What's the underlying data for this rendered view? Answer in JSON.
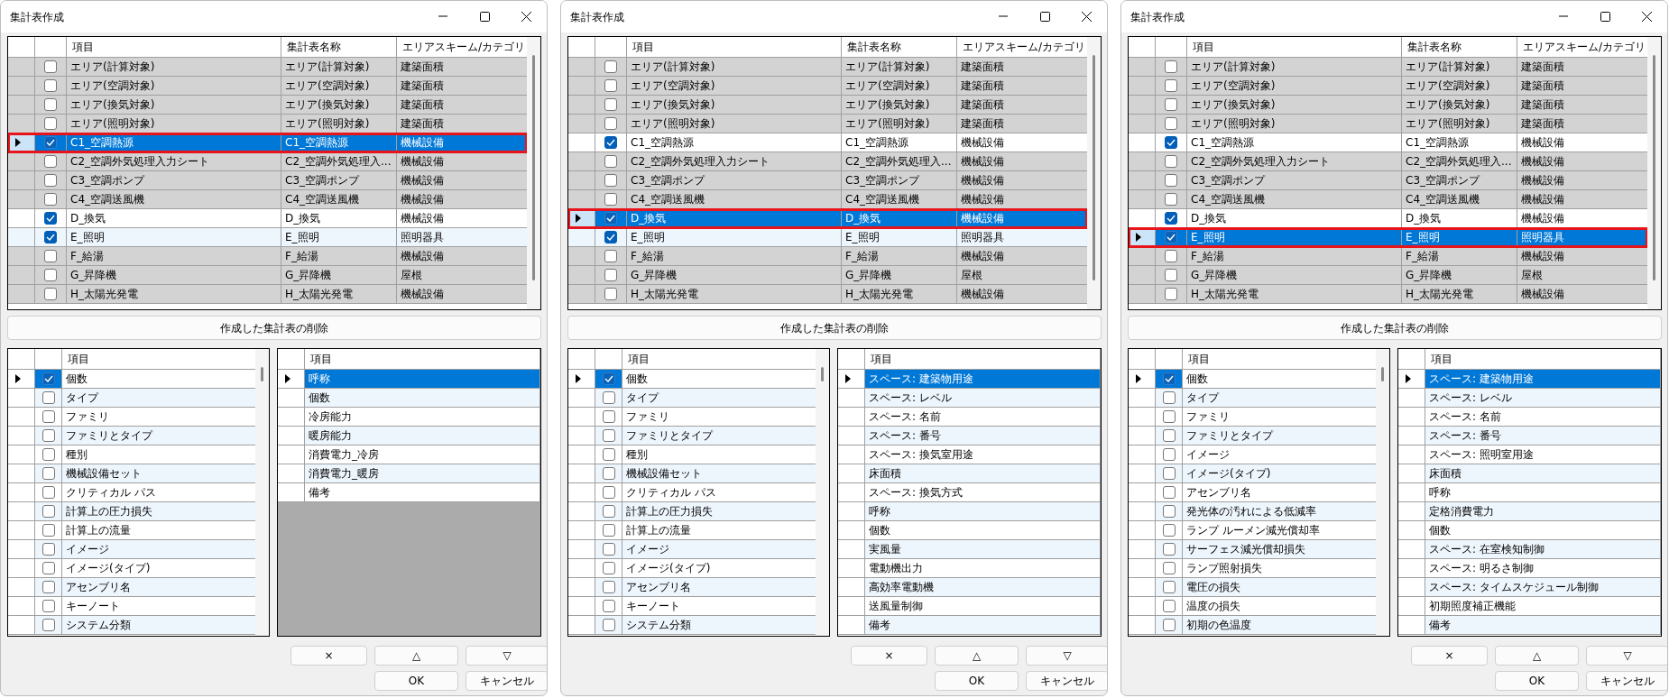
{
  "dialogs": [
    {
      "title": "集計表作成",
      "schedule_table": {
        "columns": [
          "項目",
          "集計表名称",
          "エリアスキーム/カテゴリ"
        ],
        "rows": [
          {
            "checked": false,
            "selected": false,
            "item": "エリア(計算対象)",
            "schedule_name": "エリア(計算対象)",
            "category": "建築面積"
          },
          {
            "checked": false,
            "selected": false,
            "item": "エリア(空調対象)",
            "schedule_name": "エリア(空調対象)",
            "category": "建築面積"
          },
          {
            "checked": false,
            "selected": false,
            "item": "エリア(換気対象)",
            "schedule_name": "エリア(換気対象)",
            "category": "建築面積"
          },
          {
            "checked": false,
            "selected": false,
            "item": "エリア(照明対象)",
            "schedule_name": "エリア(照明対象)",
            "category": "建築面積"
          },
          {
            "checked": true,
            "selected": true,
            "item": "C1_空調熱源",
            "schedule_name": "C1_空調熱源",
            "category": "機械設備"
          },
          {
            "checked": false,
            "selected": false,
            "item": "C2_空調外気処理入力シート",
            "schedule_name": "C2_空調外気処理入...",
            "category": "機械設備"
          },
          {
            "checked": false,
            "selected": false,
            "item": "C3_空調ポンプ",
            "schedule_name": "C3_空調ポンプ",
            "category": "機械設備"
          },
          {
            "checked": false,
            "selected": false,
            "item": "C4_空調送風機",
            "schedule_name": "C4_空調送風機",
            "category": "機械設備"
          },
          {
            "checked": true,
            "selected": false,
            "item": "D_換気",
            "schedule_name": "D_換気",
            "category": "機械設備"
          },
          {
            "checked": true,
            "selected": false,
            "item": "E_照明",
            "schedule_name": "E_照明",
            "category": "照明器具"
          },
          {
            "checked": false,
            "selected": false,
            "item": "F_給湯",
            "schedule_name": "F_給湯",
            "category": "機械設備"
          },
          {
            "checked": false,
            "selected": false,
            "item": "G_昇降機",
            "schedule_name": "G_昇降機",
            "category": "屋根"
          },
          {
            "checked": false,
            "selected": false,
            "item": "H_太陽光発電",
            "schedule_name": "H_太陽光発電",
            "category": "機械設備"
          }
        ]
      },
      "delete_button": "作成した集計表の削除",
      "field_list": {
        "column": "項目",
        "rows": [
          {
            "label": "個数",
            "checked": true,
            "selected": true
          },
          {
            "label": "タイプ",
            "checked": false,
            "selected": false
          },
          {
            "label": "ファミリ",
            "checked": false,
            "selected": false
          },
          {
            "label": "ファミリとタイプ",
            "checked": false,
            "selected": false
          },
          {
            "label": "種別",
            "checked": false,
            "selected": false
          },
          {
            "label": "機械設備セット",
            "checked": false,
            "selected": false
          },
          {
            "label": "クリティカル パス",
            "checked": false,
            "selected": false
          },
          {
            "label": "計算上の圧力損失",
            "checked": false,
            "selected": false
          },
          {
            "label": "計算上の流量",
            "checked": false,
            "selected": false
          },
          {
            "label": "イメージ",
            "checked": false,
            "selected": false
          },
          {
            "label": "イメージ(タイプ)",
            "checked": false,
            "selected": false
          },
          {
            "label": "アセンブリ名",
            "checked": false,
            "selected": false
          },
          {
            "label": "キーノート",
            "checked": false,
            "selected": false
          },
          {
            "label": "システム分類",
            "checked": false,
            "selected": false
          }
        ]
      },
      "selected_fields": {
        "column": "項目",
        "rows": [
          {
            "label": "呼称",
            "selected": true
          },
          {
            "label": "個数",
            "selected": false
          },
          {
            "label": "冷房能力",
            "selected": false
          },
          {
            "label": "暖房能力",
            "selected": false
          },
          {
            "label": "消費電力_冷房",
            "selected": false
          },
          {
            "label": "消費電力_暖房",
            "selected": false
          },
          {
            "label": "備考",
            "selected": false
          }
        ]
      },
      "buttons": [
        "×",
        "△",
        "▽",
        "OK",
        "キャンセル"
      ]
    },
    {
      "title": "集計表作成",
      "schedule_table": {
        "columns": [
          "項目",
          "集計表名称",
          "エリアスキーム/カテゴリ"
        ],
        "rows": [
          {
            "checked": false,
            "selected": false,
            "item": "エリア(計算対象)",
            "schedule_name": "エリア(計算対象)",
            "category": "建築面積"
          },
          {
            "checked": false,
            "selected": false,
            "item": "エリア(空調対象)",
            "schedule_name": "エリア(空調対象)",
            "category": "建築面積"
          },
          {
            "checked": false,
            "selected": false,
            "item": "エリア(換気対象)",
            "schedule_name": "エリア(換気対象)",
            "category": "建築面積"
          },
          {
            "checked": false,
            "selected": false,
            "item": "エリア(照明対象)",
            "schedule_name": "エリア(照明対象)",
            "category": "建築面積"
          },
          {
            "checked": true,
            "selected": false,
            "item": "C1_空調熱源",
            "schedule_name": "C1_空調熱源",
            "category": "機械設備"
          },
          {
            "checked": false,
            "selected": false,
            "item": "C2_空調外気処理入力シート",
            "schedule_name": "C2_空調外気処理入...",
            "category": "機械設備"
          },
          {
            "checked": false,
            "selected": false,
            "item": "C3_空調ポンプ",
            "schedule_name": "C3_空調ポンプ",
            "category": "機械設備"
          },
          {
            "checked": false,
            "selected": false,
            "item": "C4_空調送風機",
            "schedule_name": "C4_空調送風機",
            "category": "機械設備"
          },
          {
            "checked": true,
            "selected": true,
            "item": "D_換気",
            "schedule_name": "D_換気",
            "category": "機械設備"
          },
          {
            "checked": true,
            "selected": false,
            "item": "E_照明",
            "schedule_name": "E_照明",
            "category": "照明器具"
          },
          {
            "checked": false,
            "selected": false,
            "item": "F_給湯",
            "schedule_name": "F_給湯",
            "category": "機械設備"
          },
          {
            "checked": false,
            "selected": false,
            "item": "G_昇降機",
            "schedule_name": "G_昇降機",
            "category": "屋根"
          },
          {
            "checked": false,
            "selected": false,
            "item": "H_太陽光発電",
            "schedule_name": "H_太陽光発電",
            "category": "機械設備"
          }
        ]
      },
      "delete_button": "作成した集計表の削除",
      "field_list": {
        "column": "項目",
        "rows": [
          {
            "label": "個数",
            "checked": true,
            "selected": true
          },
          {
            "label": "タイプ",
            "checked": false,
            "selected": false
          },
          {
            "label": "ファミリ",
            "checked": false,
            "selected": false
          },
          {
            "label": "ファミリとタイプ",
            "checked": false,
            "selected": false
          },
          {
            "label": "種別",
            "checked": false,
            "selected": false
          },
          {
            "label": "機械設備セット",
            "checked": false,
            "selected": false
          },
          {
            "label": "クリティカル パス",
            "checked": false,
            "selected": false
          },
          {
            "label": "計算上の圧力損失",
            "checked": false,
            "selected": false
          },
          {
            "label": "計算上の流量",
            "checked": false,
            "selected": false
          },
          {
            "label": "イメージ",
            "checked": false,
            "selected": false
          },
          {
            "label": "イメージ(タイプ)",
            "checked": false,
            "selected": false
          },
          {
            "label": "アセンブリ名",
            "checked": false,
            "selected": false
          },
          {
            "label": "キーノート",
            "checked": false,
            "selected": false
          },
          {
            "label": "システム分類",
            "checked": false,
            "selected": false
          }
        ]
      },
      "selected_fields": {
        "column": "項目",
        "rows": [
          {
            "label": "スペース: 建築物用途",
            "selected": true
          },
          {
            "label": "スペース: レベル",
            "selected": false
          },
          {
            "label": "スペース: 名前",
            "selected": false
          },
          {
            "label": "スペース: 番号",
            "selected": false
          },
          {
            "label": "スペース: 換気室用途",
            "selected": false
          },
          {
            "label": "床面積",
            "selected": false
          },
          {
            "label": "スペース: 換気方式",
            "selected": false
          },
          {
            "label": "呼称",
            "selected": false
          },
          {
            "label": "個数",
            "selected": false
          },
          {
            "label": "実風量",
            "selected": false
          },
          {
            "label": "電動機出力",
            "selected": false
          },
          {
            "label": "高効率電動機",
            "selected": false
          },
          {
            "label": "送風量制御",
            "selected": false
          },
          {
            "label": "備考",
            "selected": false
          }
        ]
      },
      "buttons": [
        "×",
        "△",
        "▽",
        "OK",
        "キャンセル"
      ]
    },
    {
      "title": "集計表作成",
      "schedule_table": {
        "columns": [
          "項目",
          "集計表名称",
          "エリアスキーム/カテゴリ"
        ],
        "rows": [
          {
            "checked": false,
            "selected": false,
            "item": "エリア(計算対象)",
            "schedule_name": "エリア(計算対象)",
            "category": "建築面積"
          },
          {
            "checked": false,
            "selected": false,
            "item": "エリア(空調対象)",
            "schedule_name": "エリア(空調対象)",
            "category": "建築面積"
          },
          {
            "checked": false,
            "selected": false,
            "item": "エリア(換気対象)",
            "schedule_name": "エリア(換気対象)",
            "category": "建築面積"
          },
          {
            "checked": false,
            "selected": false,
            "item": "エリア(照明対象)",
            "schedule_name": "エリア(照明対象)",
            "category": "建築面積"
          },
          {
            "checked": true,
            "selected": false,
            "item": "C1_空調熱源",
            "schedule_name": "C1_空調熱源",
            "category": "機械設備"
          },
          {
            "checked": false,
            "selected": false,
            "item": "C2_空調外気処理入力シート",
            "schedule_name": "C2_空調外気処理入...",
            "category": "機械設備"
          },
          {
            "checked": false,
            "selected": false,
            "item": "C3_空調ポンプ",
            "schedule_name": "C3_空調ポンプ",
            "category": "機械設備"
          },
          {
            "checked": false,
            "selected": false,
            "item": "C4_空調送風機",
            "schedule_name": "C4_空調送風機",
            "category": "機械設備"
          },
          {
            "checked": true,
            "selected": false,
            "item": "D_換気",
            "schedule_name": "D_換気",
            "category": "機械設備"
          },
          {
            "checked": true,
            "selected": true,
            "item": "E_照明",
            "schedule_name": "E_照明",
            "category": "照明器具"
          },
          {
            "checked": false,
            "selected": false,
            "item": "F_給湯",
            "schedule_name": "F_給湯",
            "category": "機械設備"
          },
          {
            "checked": false,
            "selected": false,
            "item": "G_昇降機",
            "schedule_name": "G_昇降機",
            "category": "屋根"
          },
          {
            "checked": false,
            "selected": false,
            "item": "H_太陽光発電",
            "schedule_name": "H_太陽光発電",
            "category": "機械設備"
          }
        ]
      },
      "delete_button": "作成した集計表の削除",
      "field_list": {
        "column": "項目",
        "rows": [
          {
            "label": "個数",
            "checked": true,
            "selected": true
          },
          {
            "label": "タイプ",
            "checked": false,
            "selected": false
          },
          {
            "label": "ファミリ",
            "checked": false,
            "selected": false
          },
          {
            "label": "ファミリとタイプ",
            "checked": false,
            "selected": false
          },
          {
            "label": "イメージ",
            "checked": false,
            "selected": false
          },
          {
            "label": "イメージ(タイプ)",
            "checked": false,
            "selected": false
          },
          {
            "label": "アセンブリ名",
            "checked": false,
            "selected": false
          },
          {
            "label": "発光体の汚れによる低減率",
            "checked": false,
            "selected": false
          },
          {
            "label": "ランプ ルーメン減光償却率",
            "checked": false,
            "selected": false
          },
          {
            "label": "サーフェス減光償却損失",
            "checked": false,
            "selected": false
          },
          {
            "label": "ランプ照射損失",
            "checked": false,
            "selected": false
          },
          {
            "label": "電圧の損失",
            "checked": false,
            "selected": false
          },
          {
            "label": "温度の損失",
            "checked": false,
            "selected": false
          },
          {
            "label": "初期の色温度",
            "checked": false,
            "selected": false
          }
        ]
      },
      "selected_fields": {
        "column": "項目",
        "rows": [
          {
            "label": "スペース: 建築物用途",
            "selected": true
          },
          {
            "label": "スペース: レベル",
            "selected": false
          },
          {
            "label": "スペース: 名前",
            "selected": false
          },
          {
            "label": "スペース: 番号",
            "selected": false
          },
          {
            "label": "スペース: 照明室用途",
            "selected": false
          },
          {
            "label": "床面積",
            "selected": false
          },
          {
            "label": "呼称",
            "selected": false
          },
          {
            "label": "定格消費電力",
            "selected": false
          },
          {
            "label": "個数",
            "selected": false
          },
          {
            "label": "スペース: 在室検知制御",
            "selected": false
          },
          {
            "label": "スペース: 明るさ制御",
            "selected": false
          },
          {
            "label": "スペース: タイムスケジュール制御",
            "selected": false
          },
          {
            "label": "初期照度補正機能",
            "selected": false
          },
          {
            "label": "備考",
            "selected": false
          }
        ]
      },
      "buttons": [
        "×",
        "△",
        "▽",
        "OK",
        "キャンセル"
      ]
    }
  ]
}
